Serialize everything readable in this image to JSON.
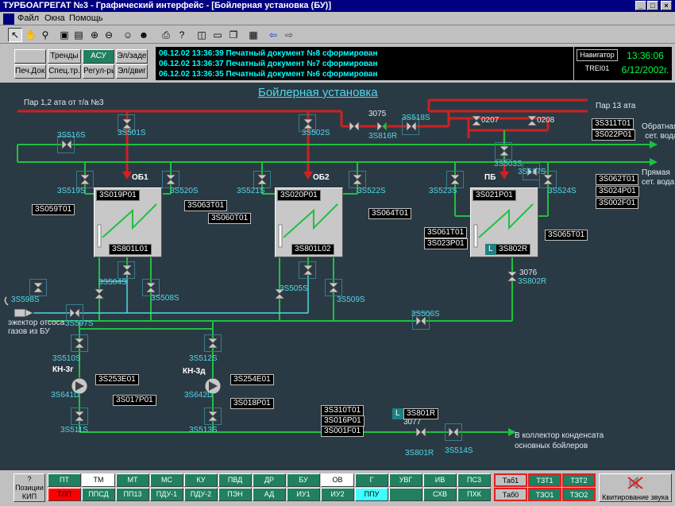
{
  "window": {
    "title": "ТУРБОАГРЕГАТ №3 - Графический интерфейс - [Бойлерная установка (БУ)]"
  },
  "menu": {
    "file": "Файл",
    "windows": "Окна",
    "help": "Помощь"
  },
  "top_buttons": {
    "blank": "",
    "trends": "Тренды",
    "asu": "АСУ",
    "el_sade": "Эл/заде",
    "pech_dok": "Печ.Док.",
    "spec_tr": "Спец.тр.",
    "regul": "Регул-ры",
    "el_dvig": "Эл/двиг"
  },
  "events": [
    "06.12.02 13:36:39  Печатный документ №8 сформирован",
    "06.12.02 13:36:37  Печатный документ №7 сформирован",
    "06.12.02 13:36:35  Печатный документ №6 сформирован"
  ],
  "clock": {
    "navigator": "Навигатор",
    "station": "TREI01",
    "time": "13:36:06",
    "date": "6/12/2002г."
  },
  "diagram": {
    "title": "Бойлерная установка",
    "labels": {
      "steam_in": "Пар 1,2 ата от т/а №3",
      "steam_13": "Пар 13 ата",
      "return_water": "Обратная\nсет. вода",
      "direct_water": "Прямая\nсет. вода",
      "ejector": "эжектор отсоса\nгазов из БУ",
      "condensate": "В коллектор конденсата\nосновных бойлеров",
      "ob1": "ОБ1",
      "ob2": "ОБ2",
      "pb": "ПБ",
      "kn3g": "КН-3г",
      "kn3d": "КН-3д",
      "v3075": "3075",
      "v3076": "3076",
      "v3077": "3077",
      "v0207": "0207",
      "v0208": "0208"
    },
    "valves": {
      "s516": "3S516S",
      "s501": "3S501S",
      "s502": "3S502S",
      "s816r": "3S816R",
      "s518": "3S518S",
      "s503": "3S503S",
      "s517": "3S517S",
      "s519": "3S519S",
      "s520": "3S520S",
      "s521": "3S521S",
      "s522": "3S522S",
      "s523": "3S523S",
      "s524": "3S524S",
      "s504": "3S504S",
      "s508": "3S508S",
      "s505": "3S505S",
      "s509": "3S509S",
      "s802r": "3S802R",
      "s598": "3S598S",
      "s597": "3S597S",
      "s506": "3S506S",
      "s510": "3S510S",
      "s512": "3S512S",
      "s641d_a": "3S641D",
      "s642d": "3S642D",
      "s511": "3S511S",
      "s513": "3S513S",
      "s801r": "3S801R",
      "s514": "3S514S"
    },
    "tags": {
      "t311": "3S311T01",
      "p022": "3S022P01",
      "t062": "3S062T01",
      "p024": "3S024P01",
      "f002": "3S002F01",
      "p019": "3S019P01",
      "t063": "3S063T01",
      "t059": "3S059T01",
      "l801": "3S801L01",
      "p020": "3S020P01",
      "t060": "3S060T01",
      "t064": "3S064T01",
      "l802": "3S801L02",
      "p021": "3S021P01",
      "t061": "3S061T01",
      "p023": "3S023P01",
      "r802": "3S802R",
      "t065": "3S065T01",
      "e253": "3S253E01",
      "p017": "3S017P01",
      "e254": "3S254E01",
      "p018": "3S018P01",
      "t310": "3S310T01",
      "p016": "3S016P01",
      "f001": "3S001F01",
      "r801": "3S801R",
      "l_mark": "L"
    }
  },
  "bottom": {
    "positions": "?\nПозиции\nКИП",
    "row1": [
      "ПТ",
      "ТМ",
      "МТ",
      "МС",
      "КУ",
      "ПВД",
      "ДР",
      "БУ",
      "ОВ",
      "Г",
      "УВГ",
      "ИВ",
      "ПС3",
      "Таб1",
      "ТЗТ1",
      "ТЗТ2"
    ],
    "row2": [
      "ТЛП",
      "ППСД",
      "ПП13",
      "ПДУ-1",
      "ПДУ-2",
      "ПЭН",
      "АД",
      "ИУ1",
      "ИУ2",
      "ППУ",
      "",
      "СХВ",
      "ПХК",
      "Таб0",
      "ТЗО1",
      "ТЗО2"
    ],
    "ack_sound": "Квитирование звука"
  }
}
